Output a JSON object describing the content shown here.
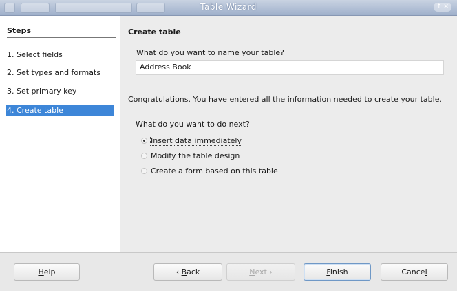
{
  "window": {
    "title": "Table Wizard",
    "controls": "↑ ✕"
  },
  "steps": {
    "heading": "Steps",
    "items": [
      {
        "label": "1. Select fields",
        "active": false
      },
      {
        "label": "2. Set types and formats",
        "active": false
      },
      {
        "label": "3. Set primary key",
        "active": false
      },
      {
        "label": "4. Create table",
        "active": true
      }
    ]
  },
  "main": {
    "section_title": "Create table",
    "name_question_mnemonic": "W",
    "name_question_rest": "hat do you want to name your table?",
    "table_name_value": "Address Book",
    "congrats": "Congratulations. You have entered all the information needed to create your table.",
    "next_question": "What do you want to do next?",
    "options": [
      {
        "label": "Insert data immediately",
        "checked": true
      },
      {
        "label": "Modify the table design",
        "checked": false
      },
      {
        "label": "Create a form based on this table",
        "checked": false
      }
    ]
  },
  "buttons": {
    "help": {
      "mnemonic": "H",
      "rest": "elp"
    },
    "back": {
      "prefix": "‹ ",
      "mnemonic": "B",
      "rest": "ack"
    },
    "next": {
      "mnemonic": "N",
      "rest": "ext ›",
      "disabled": true
    },
    "finish": {
      "mnemonic": "F",
      "rest": "inish"
    },
    "cancel": {
      "text": "Cance",
      "mnemonic": "l"
    }
  }
}
